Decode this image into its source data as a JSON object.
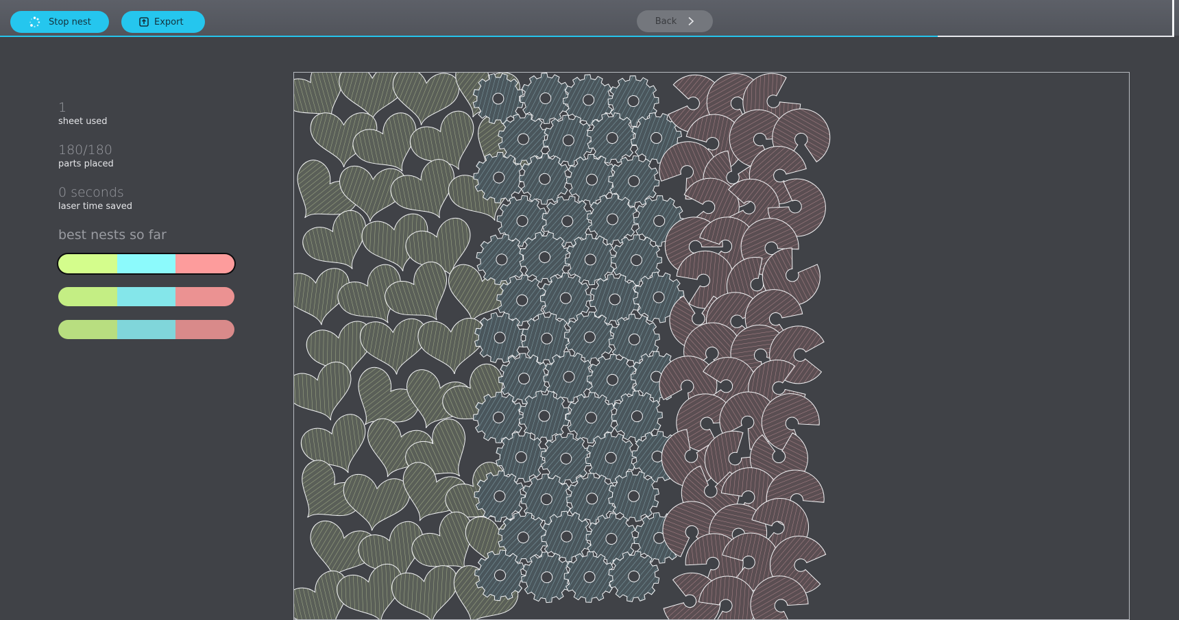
{
  "toolbar": {
    "stop_label": "Stop nest",
    "stop_icon": "spinner-icon",
    "export_label": "Export",
    "export_icon": "export-icon",
    "back_label": "Back",
    "back_icon": "chevron-right-icon",
    "progress_fraction": 0.8,
    "accent_color": "#25c6ee"
  },
  "stats": {
    "sheets_value": "1",
    "sheets_label": "sheet used",
    "parts_value": "180/180",
    "parts_label": "parts placed",
    "time_value": "0 seconds",
    "time_label": "laser time saved"
  },
  "best_nests": {
    "title": "best nests so far",
    "bars": [
      {
        "selected": true,
        "segments": [
          0.333,
          0.333,
          0.333
        ],
        "colors": [
          "#d4fd8c",
          "#8cfafc",
          "#fd9c9c"
        ]
      },
      {
        "selected": false,
        "segments": [
          0.333,
          0.333,
          0.333
        ],
        "colors": [
          "#c4ee84",
          "#84e6ea",
          "#eb9292"
        ]
      },
      {
        "selected": false,
        "segments": [
          0.333,
          0.333,
          0.333
        ],
        "colors": [
          "#b8de80",
          "#80d6da",
          "#d98a8a"
        ]
      }
    ]
  },
  "sheet": {
    "part_types": [
      {
        "name": "heart",
        "count": 60,
        "fill": "#5a5f58",
        "hatch": "#c9d8a3"
      },
      {
        "name": "gear",
        "count": 60,
        "fill": "#4a565c",
        "hatch": "#9fc8d0"
      },
      {
        "name": "crescent",
        "count": 60,
        "fill": "#5a4e52",
        "hatch": "#d9a3a8"
      }
    ],
    "outline_color": "#f4f5f7"
  }
}
